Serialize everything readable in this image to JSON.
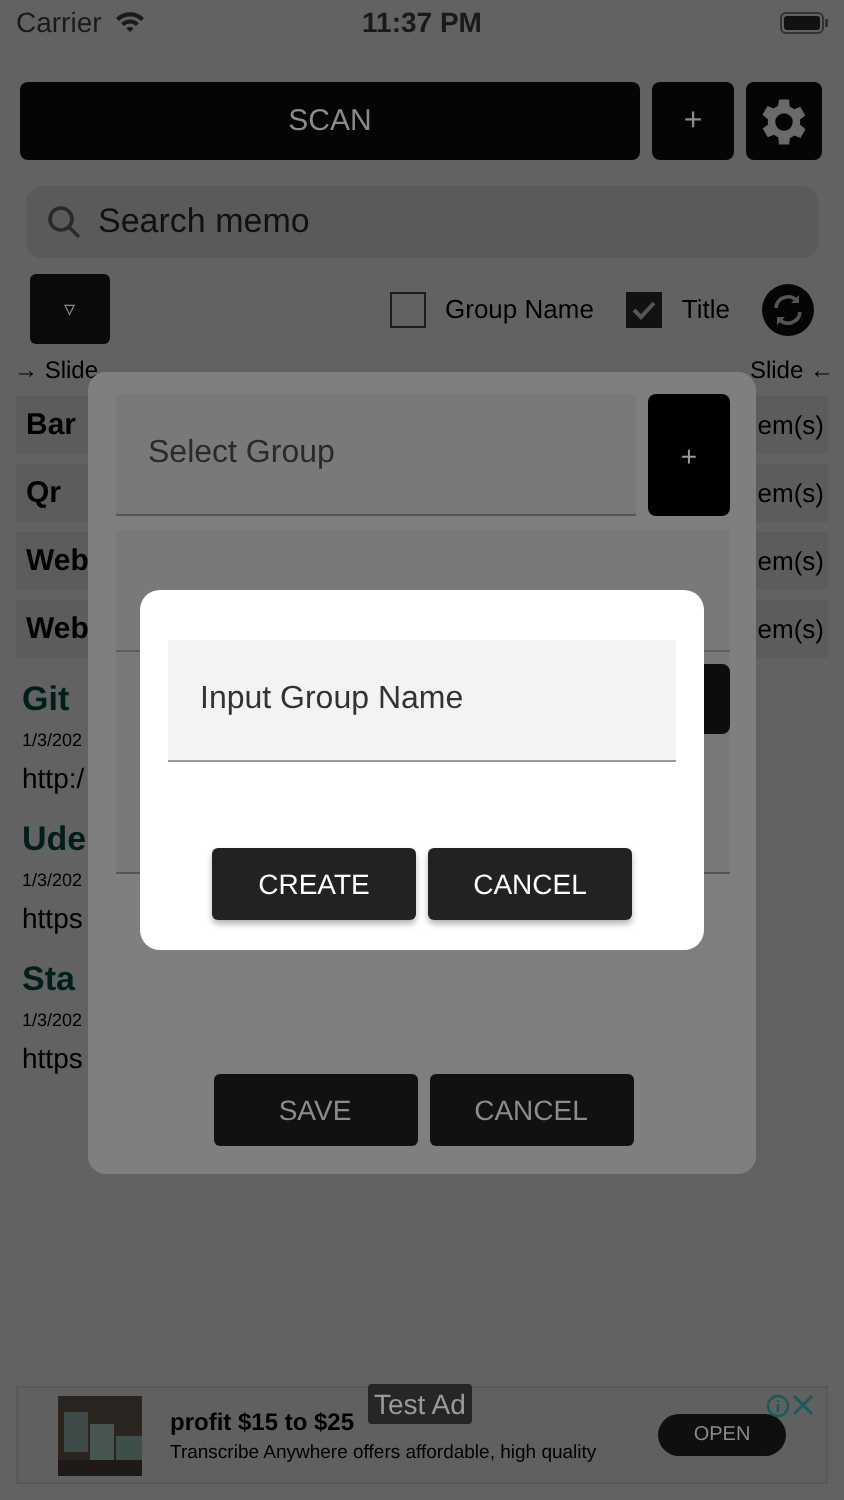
{
  "status_bar": {
    "carrier": "Carrier",
    "time": "11:37 PM"
  },
  "toolbar": {
    "scan": "SCAN",
    "add": "+"
  },
  "search": {
    "placeholder": "Search memo"
  },
  "sort_button": "▿",
  "filters": [
    {
      "label": "Group Name",
      "checked": false
    },
    {
      "label": "Title",
      "checked": true
    }
  ],
  "hints": {
    "left": "→ Slide",
    "right": "Slide ←"
  },
  "groups": [
    {
      "name": "Bar",
      "count": "em(s)"
    },
    {
      "name": "Qr",
      "count": "em(s)"
    },
    {
      "name": "Web",
      "count": "em(s)"
    },
    {
      "name": "Web",
      "count": "em(s)"
    }
  ],
  "memos": [
    {
      "title": "Git",
      "date": "1/3/202",
      "url": "http:/"
    },
    {
      "title": "Ude",
      "date": "1/3/202",
      "url": "https"
    },
    {
      "title": "Sta",
      "date": "1/3/202",
      "url": "https"
    }
  ],
  "memo_dialog": {
    "group_placeholder": "Select Group",
    "add": "+",
    "buttons": [
      "SAVE",
      "CANCEL"
    ]
  },
  "group_dialog": {
    "placeholder": "Input Group Name",
    "buttons": [
      "CREATE",
      "CANCEL"
    ]
  },
  "ad": {
    "label": "Test Ad",
    "title": "profit $15 to $25",
    "text": "Transcribe Anywhere offers affordable, high quality",
    "button": "OPEN"
  }
}
